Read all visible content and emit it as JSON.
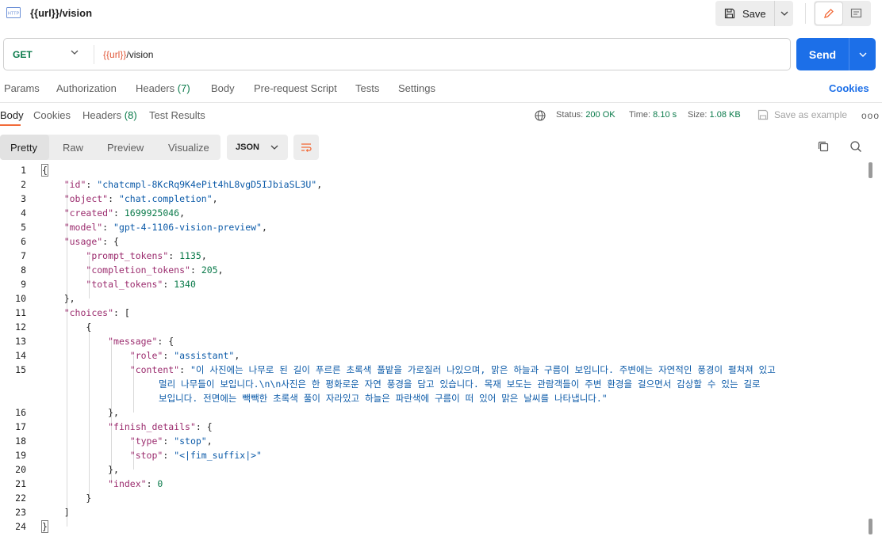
{
  "request": {
    "badge": "HTTP",
    "title": "{{url}}/vision",
    "save_label": "Save",
    "method": "GET",
    "url_variable": "{{url}}",
    "url_path": "/vision",
    "send_label": "Send"
  },
  "request_tabs": [
    "Params",
    "Authorization",
    "Headers",
    "(7)",
    "Body",
    "Pre-request Script",
    "Tests",
    "Settings"
  ],
  "cookies_label": "Cookies",
  "response_tabs": {
    "body": "Body",
    "cookies": "Cookies",
    "headers": "Headers",
    "headers_count": "(8)",
    "test_results": "Test Results"
  },
  "response_meta": {
    "status_label": "Status:",
    "status_value": "200 OK",
    "time_label": "Time:",
    "time_value": "8.10 s",
    "size_label": "Size:",
    "size_value": "1.08 KB",
    "save_example": "Save as example",
    "more": "ooo"
  },
  "view_modes": [
    "Pretty",
    "Raw",
    "Preview",
    "Visualize"
  ],
  "format": "JSON",
  "code": {
    "line_numbers": [
      "1",
      "2",
      "3",
      "4",
      "5",
      "6",
      "7",
      "8",
      "9",
      "10",
      "11",
      "12",
      "13",
      "14",
      "15",
      "16",
      "17",
      "18",
      "19",
      "20",
      "21",
      "22",
      "23",
      "24"
    ],
    "id_key": "\"id\"",
    "id_val": "\"chatcmpl-8KcRq9K4ePit4hL8vgD5IJbiaSL3U\"",
    "object_key": "\"object\"",
    "object_val": "\"chat.completion\"",
    "created_key": "\"created\"",
    "created_val": "1699925046",
    "model_key": "\"model\"",
    "model_val": "\"gpt-4-1106-vision-preview\"",
    "usage_key": "\"usage\"",
    "prompt_tokens_key": "\"prompt_tokens\"",
    "prompt_tokens_val": "1135",
    "completion_tokens_key": "\"completion_tokens\"",
    "completion_tokens_val": "205",
    "total_tokens_key": "\"total_tokens\"",
    "total_tokens_val": "1340",
    "choices_key": "\"choices\"",
    "message_key": "\"message\"",
    "role_key": "\"role\"",
    "role_val": "\"assistant\"",
    "content_key": "\"content\"",
    "content_line1": "\"이 사진에는 나무로 된 길이 푸르른 초록색 풀밭을 가로질러 나있으며, 맑은 하늘과 구름이 보입니다. 주변에는 자연적인 풍경이 펼쳐져 있고",
    "content_line2": "멀리 나무들이 보입니다.\\n\\n사진은 한 평화로운 자연 풍경을 담고 있습니다. 목재 보도는 관람객들이 주변 환경을 걸으면서 감상할 수 있는 길로",
    "content_line3": "보입니다. 전면에는 빽빽한 초록색 풀이 자라있고 하늘은 파란색에 구름이 떠 있어 맑은 날씨를 나타냅니다.\"",
    "finish_details_key": "\"finish_details\"",
    "type_key": "\"type\"",
    "type_val": "\"stop\"",
    "stop_key": "\"stop\"",
    "stop_val": "\"<|fim_suffix|>\"",
    "index_key": "\"index\"",
    "index_val": "0"
  },
  "colors": {
    "accent": "#f26b3a",
    "send": "#1c6fe8",
    "method_get": "#0a7a4a",
    "json_key": "#9b2c6e",
    "json_string": "#0b5aa8",
    "json_number": "#0a7a4a"
  }
}
